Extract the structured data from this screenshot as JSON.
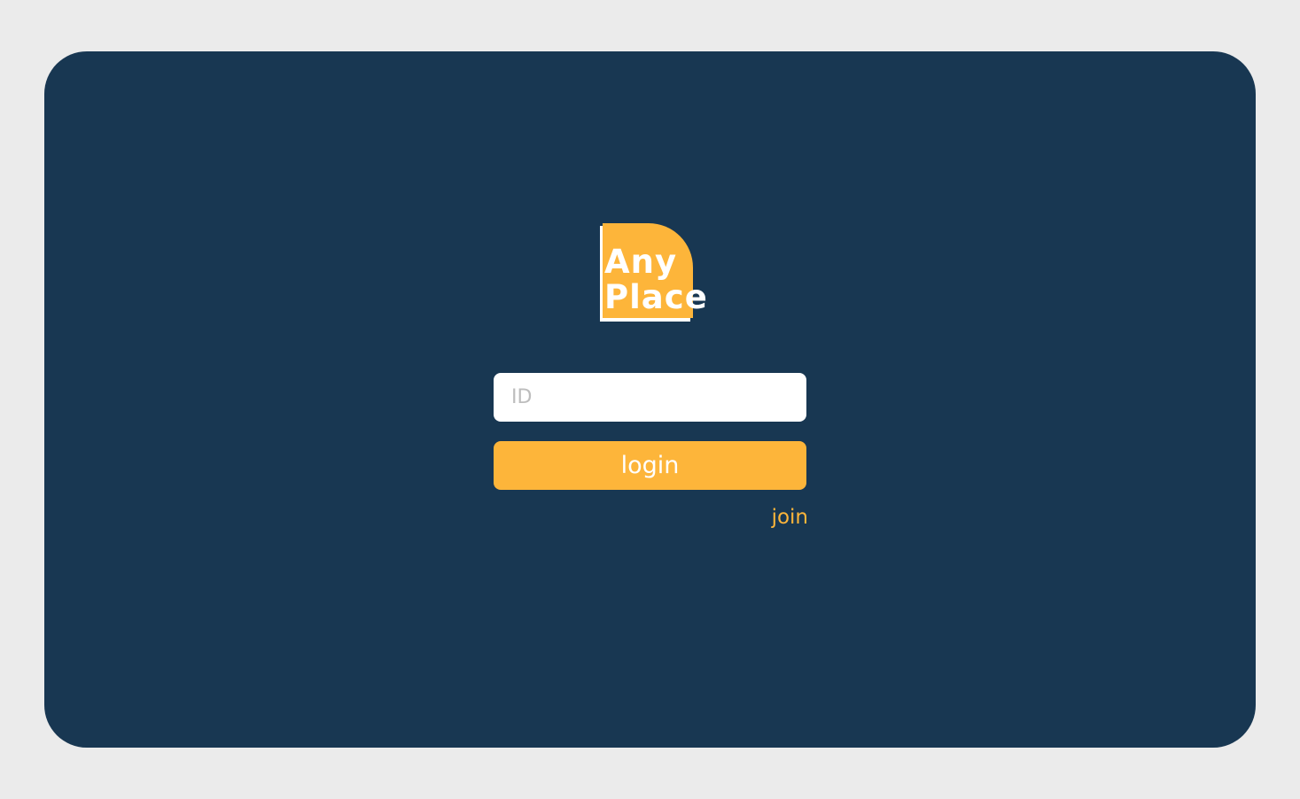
{
  "logo": {
    "line1": "Any",
    "line2": "Place"
  },
  "login_form": {
    "id_placeholder": "ID",
    "id_value": "",
    "login_label": "login",
    "join_label": "join"
  },
  "colors": {
    "page_background": "#ebebeb",
    "card_background": "#183752",
    "accent": "#fdb53a",
    "input_background": "#ffffff",
    "placeholder": "#bdbdbd",
    "text_on_accent": "#ffffff"
  }
}
